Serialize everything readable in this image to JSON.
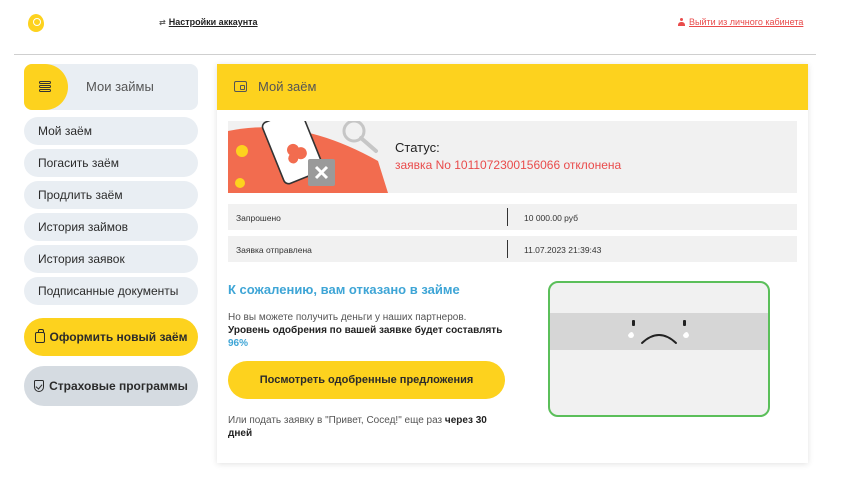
{
  "header": {
    "settings_label": "Настройки аккаунта",
    "logout_label": "Выйти из личного кабинета"
  },
  "sidebar": {
    "title": "Мои займы",
    "items": [
      {
        "label": "Мой заём"
      },
      {
        "label": "Погасить заём"
      },
      {
        "label": "Продлить заём"
      },
      {
        "label": "История займов"
      },
      {
        "label": "История заявок"
      },
      {
        "label": "Подписанные документы"
      }
    ],
    "new_loan_label": "Оформить новый заём",
    "insurance_label": "Страховые программы"
  },
  "main": {
    "title": "Мой заём",
    "status_label": "Статус:",
    "status_value": "заявка No 1011072300156066 отклонена",
    "rows": [
      {
        "key": "Запрошено",
        "value": "10 000.00 руб"
      },
      {
        "key": "Заявка отправлена",
        "value": "11.07.2023 21:39:43"
      }
    ],
    "reject_title": "К сожалению, вам отказано в займе",
    "partners_text": "Но вы можете получить деньги у наших партнеров.",
    "approval_text": "Уровень одобрения по вашей заявке будет составлять",
    "approval_pct": "96%",
    "offers_button": "Посмотреть одобренные предложения",
    "later_text": "Или подать заявку в \"Привет, Сосед!\" еще раз",
    "later_bold": "через 30 дней"
  },
  "colors": {
    "accent_yellow": "#fdd21e",
    "error_red": "#e94b4b",
    "info_blue": "#3ea5d6",
    "success_green": "#5bbf5a"
  }
}
